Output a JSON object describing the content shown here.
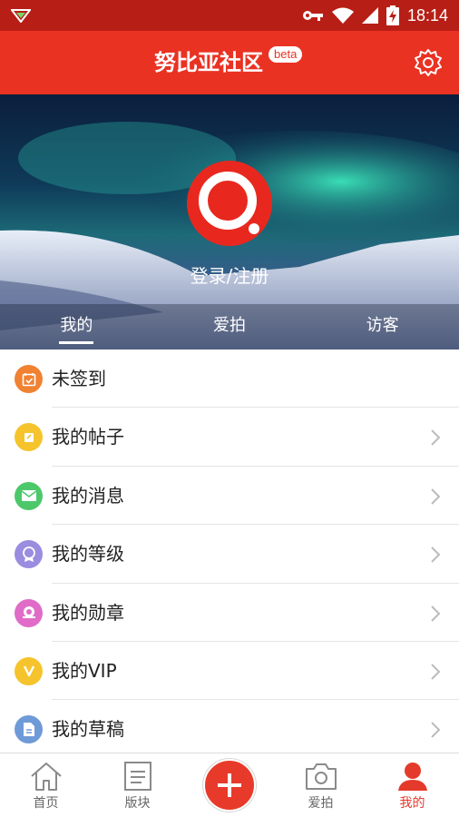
{
  "status_bar": {
    "time": "18:14",
    "icons": [
      "notification-icon",
      "vpn-key-icon",
      "wifi-icon",
      "signal-icon",
      "battery-charging-icon"
    ]
  },
  "header": {
    "title": "努比亚社区",
    "badge": "beta",
    "settings_icon": "gear-icon",
    "background_color": "#ea3223"
  },
  "hero": {
    "login_label": "登录/注册",
    "tabs": [
      {
        "label": "我的",
        "active": true
      },
      {
        "label": "爱拍",
        "active": false
      },
      {
        "label": "访客",
        "active": false
      }
    ]
  },
  "menu": [
    {
      "label": "未签到",
      "icon": "calendar-check-icon",
      "color": "#f08232",
      "chevron": false
    },
    {
      "label": "我的帖子",
      "icon": "note-icon",
      "color": "#f5c42c",
      "chevron": true
    },
    {
      "label": "我的消息",
      "icon": "envelope-icon",
      "color": "#4cc86a",
      "chevron": true
    },
    {
      "label": "我的等级",
      "icon": "badge-icon",
      "color": "#9a8de0",
      "chevron": true
    },
    {
      "label": "我的勋章",
      "icon": "medal-icon",
      "color": "#e06cc8",
      "chevron": true
    },
    {
      "label": "我的VIP",
      "icon": "vip-icon",
      "color": "#f5c42c",
      "chevron": true
    },
    {
      "label": "我的草稿",
      "icon": "draft-doc-icon",
      "color": "#6f9ad8",
      "chevron": true
    }
  ],
  "tab_bar": {
    "items": [
      {
        "label": "首页",
        "icon": "home-icon",
        "active": false
      },
      {
        "label": "版块",
        "icon": "board-list-icon",
        "active": false
      },
      {
        "label": "",
        "icon": "plus-icon",
        "active": false
      },
      {
        "label": "爱拍",
        "icon": "camera-icon",
        "active": false
      },
      {
        "label": "我的",
        "icon": "person-icon",
        "active": true
      }
    ],
    "active_color": "#e43a2c"
  }
}
